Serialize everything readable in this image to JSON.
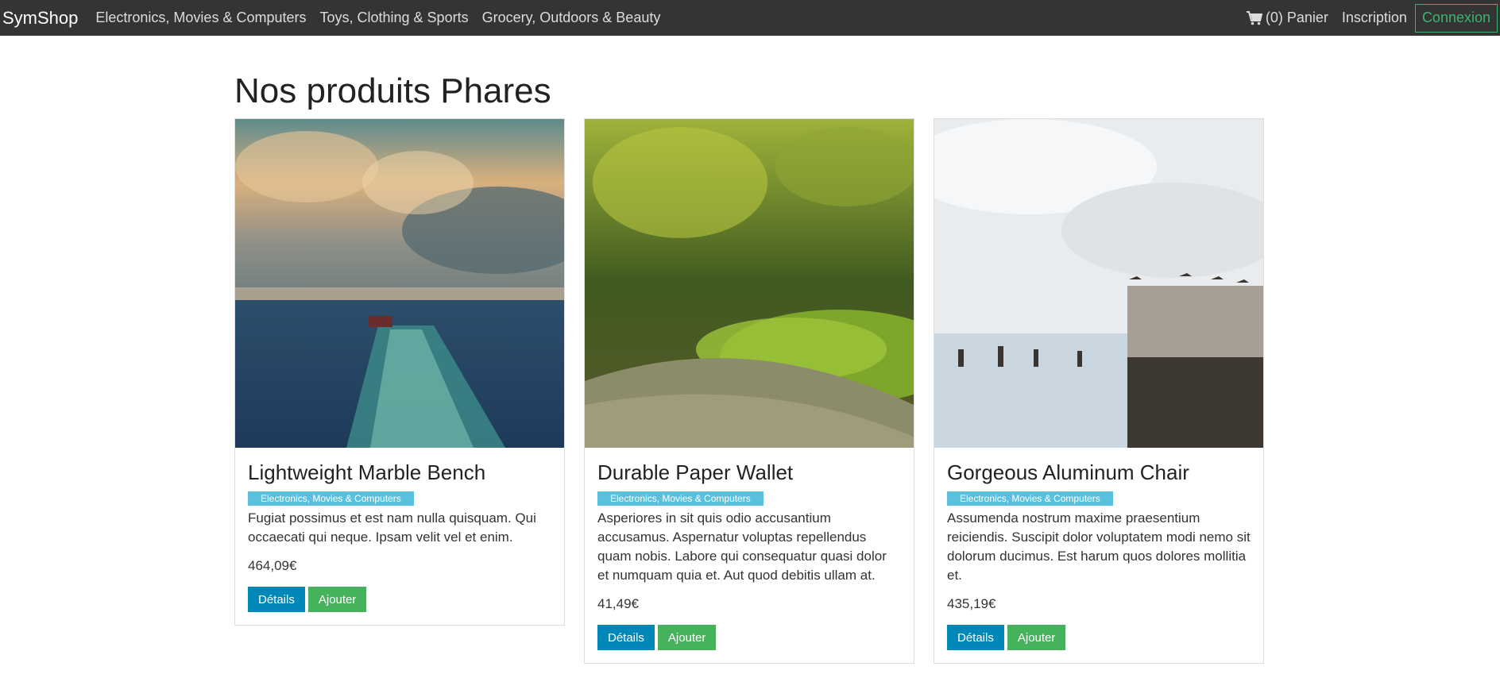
{
  "nav": {
    "brand": "SymShop",
    "links": [
      "Electronics, Movies & Computers",
      "Toys, Clothing & Sports",
      "Grocery, Outdoors & Beauty"
    ],
    "cart": "(0) Panier",
    "signup": "Inscription",
    "login": "Connexion"
  },
  "page_title": "Nos produits Phares",
  "products": [
    {
      "title": "Lightweight Marble Bench",
      "category": "Electronics, Movies & Computers",
      "description": "Fugiat possimus et est nam nulla quisquam. Qui occaecati qui neque. Ipsam velit vel et enim.",
      "price": "464,09€",
      "details_label": "Détails",
      "add_label": "Ajouter"
    },
    {
      "title": "Durable Paper Wallet",
      "category": "Electronics, Movies & Computers",
      "description": "Asperiores in sit quis odio accusantium accusamus. Aspernatur voluptas repellendus quam nobis. Labore qui consequatur quasi dolor et numquam quia et. Aut quod debitis ullam at.",
      "price": "41,49€",
      "details_label": "Détails",
      "add_label": "Ajouter"
    },
    {
      "title": "Gorgeous Aluminum Chair",
      "category": "Electronics, Movies & Computers",
      "description": "Assumenda nostrum maxime praesentium reiciendis. Suscipit dolor voluptatem modi nemo sit dolorum ducimus. Est harum quos dolores mollitia et.",
      "price": "435,19€",
      "details_label": "Détails",
      "add_label": "Ajouter"
    }
  ],
  "colors": {
    "navbar": "#343434",
    "accent_green": "#46b25c",
    "accent_blue": "#0088b8",
    "badge": "#5bc0de"
  }
}
